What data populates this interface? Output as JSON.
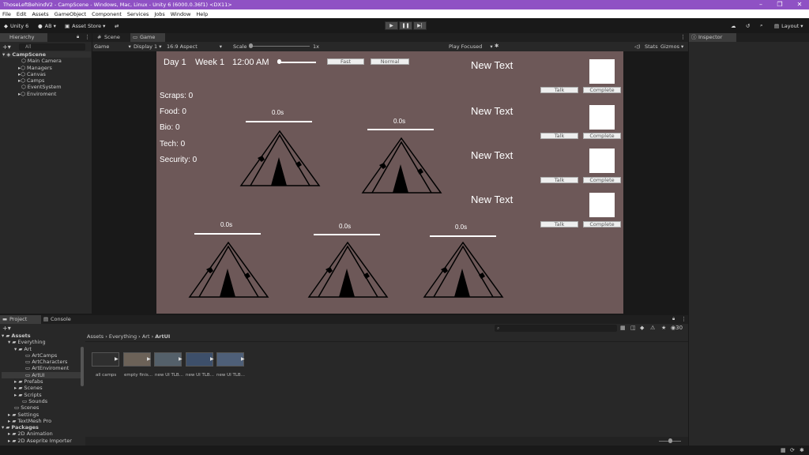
{
  "window": {
    "title": "ThoseLeftBehindV2 - CampScene - Windows, Mac, Linux - Unity 6 (6000.0.36f1) <DX11>"
  },
  "menu": [
    "File",
    "Edit",
    "Assets",
    "GameObject",
    "Component",
    "Services",
    "Jobs",
    "Window",
    "Help"
  ],
  "toolbar": {
    "unity": "Unity 6",
    "account": "AB",
    "asset_store": "Asset Store",
    "layout": "Layout"
  },
  "hierarchy": {
    "tab": "Hierarchy",
    "search_placeholder": "All",
    "scene": "CampScene",
    "items": [
      "Main Camera",
      "Managers",
      "Canvas",
      "Camps",
      "EventSystem",
      "Enviroment"
    ]
  },
  "scene_tabs": {
    "scene": "Scene",
    "game": "Game"
  },
  "game_bar": {
    "mode": "Game",
    "display": "Display 1",
    "aspect": "16:9 Aspect",
    "scale_label": "Scale",
    "scale_value": "1x",
    "play_mode": "Play Focused",
    "stats": "Stats",
    "gizmos": "Gizmos"
  },
  "inspector": {
    "tab": "Inspector"
  },
  "game": {
    "day": "Day 1",
    "week": "Week 1",
    "time": "12:00 AM",
    "fast": "Fast",
    "normal": "Normal",
    "resources": [
      "Scraps: 0",
      "Food: 0",
      "Bio: 0",
      "Tech: 0",
      "Security: 0"
    ],
    "timers": [
      "0.0s",
      "0.0s",
      "0.0s",
      "0.0s",
      "0.0s"
    ],
    "panels": [
      {
        "text": "New Text",
        "talk": "Talk",
        "complete": "Complete"
      },
      {
        "text": "New Text",
        "talk": "Talk",
        "complete": "Complete"
      },
      {
        "text": "New Text",
        "talk": "Talk",
        "complete": "Complete"
      },
      {
        "text": "New Text",
        "talk": "Talk",
        "complete": "Complete"
      }
    ]
  },
  "project": {
    "tab": "Project",
    "console_tab": "Console",
    "tree": [
      "Assets",
      "Everything",
      "Art",
      "ArtCamps",
      "ArtCharacters",
      "ArtEnviroment",
      "ArtUI",
      "Prefabs",
      "Scenes",
      "Scripts",
      "Sounds",
      "Scenes",
      "Settings",
      "TextMesh Pro",
      "Packages",
      "2D Animation",
      "2D Aseprite Importer"
    ],
    "breadcrumb": [
      "Assets",
      "Everything",
      "Art",
      "ArtUI"
    ],
    "files": [
      "all camps",
      "empty finis...",
      "new UI TLB...",
      "new UI TLB...",
      "new UI TLB..."
    ],
    "count": "30"
  }
}
